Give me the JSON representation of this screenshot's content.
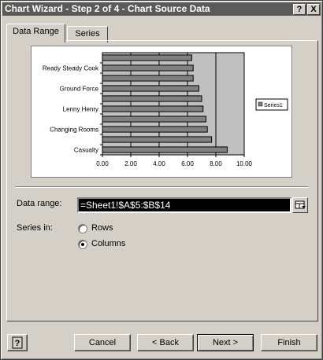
{
  "window": {
    "title": "Chart Wizard - Step 2 of 4 - Chart Source Data",
    "help_glyph": "?",
    "close_glyph": "X"
  },
  "tabs": [
    {
      "label": "Data Range",
      "active": true
    },
    {
      "label": "Series",
      "active": false
    }
  ],
  "form": {
    "data_range_label": "Data range:",
    "data_range_value": "=Sheet1!$A$5:$B$14",
    "series_in_label": "Series in:",
    "radio_rows": {
      "label": "Rows",
      "selected": false
    },
    "radio_columns": {
      "label": "Columns",
      "selected": true
    }
  },
  "buttons": {
    "cancel": "Cancel",
    "back": "< Back",
    "next": "Next >",
    "finish": "Finish"
  },
  "icons": {
    "help": "help-icon",
    "collapse": "collapse-dialog-icon"
  },
  "chart_data": {
    "type": "bar",
    "orientation": "horizontal",
    "categories": [
      "Casualty",
      "",
      "Changing Rooms",
      "",
      "Lenny Henry",
      "",
      "Ground Force",
      "",
      "Ready Steady Cook",
      ""
    ],
    "series": [
      {
        "name": "Series1",
        "values": [
          8.8,
          7.7,
          7.4,
          7.3,
          7.1,
          7.0,
          6.8,
          6.4,
          6.4,
          6.3
        ]
      }
    ],
    "xticks": [
      "0.00",
      "2.00",
      "4.00",
      "6.00",
      "8.00",
      "10.00"
    ],
    "xlim": [
      0,
      10
    ],
    "grid": true,
    "legend": "right",
    "colors": {
      "plot_bg": "#c0c0c0",
      "bar": "#808080"
    }
  }
}
